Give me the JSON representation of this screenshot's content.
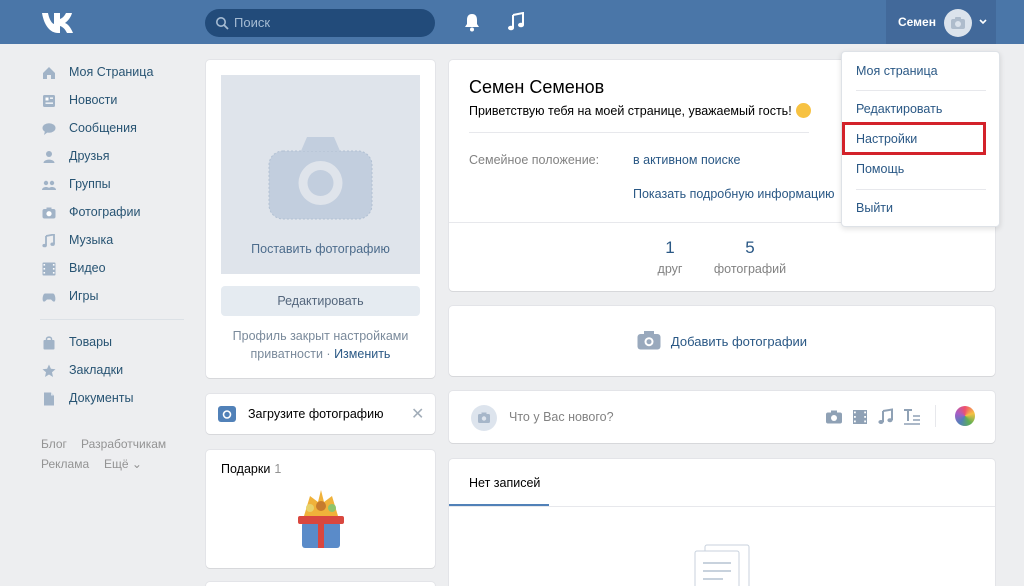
{
  "header": {
    "search_placeholder": "Поиск",
    "user_name": "Семен",
    "brand_color": "#4a76a8"
  },
  "nav": {
    "items": [
      {
        "label": "Моя Страница",
        "icon": "home-icon"
      },
      {
        "label": "Новости",
        "icon": "news-icon"
      },
      {
        "label": "Сообщения",
        "icon": "messages-icon"
      },
      {
        "label": "Друзья",
        "icon": "friends-icon"
      },
      {
        "label": "Группы",
        "icon": "groups-icon"
      },
      {
        "label": "Фотографии",
        "icon": "photos-icon"
      },
      {
        "label": "Музыка",
        "icon": "music-icon"
      },
      {
        "label": "Видео",
        "icon": "video-icon"
      },
      {
        "label": "Игры",
        "icon": "games-icon"
      },
      {
        "label": "Товары",
        "icon": "market-icon"
      },
      {
        "label": "Закладки",
        "icon": "bookmarks-icon"
      },
      {
        "label": "Документы",
        "icon": "documents-icon"
      }
    ],
    "footer": {
      "blog": "Блог",
      "developers": "Разработчикам",
      "ads": "Реклама",
      "more": "Ещё"
    }
  },
  "photo_card": {
    "placeholder_label": "Поставить фотографию",
    "edit_label": "Редактировать",
    "closed_line1": "Профиль закрыт настройками",
    "closed_line2_prefix": "приватности · ",
    "closed_link": "Изменить"
  },
  "upload_card": {
    "label": "Загрузите фотографию"
  },
  "gifts_card": {
    "title": "Подарки",
    "count": "1"
  },
  "profile": {
    "name": "Семен Семенов",
    "status": "Приветствую тебя на моей странице, уважаемый гость!",
    "relationship_label": "Семейное положение:",
    "relationship_value": "в активном поиске",
    "more_info": "Показать подробную информацию",
    "counters": [
      {
        "value": "1",
        "label": "друг"
      },
      {
        "value": "5",
        "label": "фотографий"
      }
    ]
  },
  "add_photos": {
    "label": "Добавить фотографии"
  },
  "post_box": {
    "placeholder": "Что у Вас нового?"
  },
  "wall": {
    "tab": "Нет записей"
  },
  "dropdown": {
    "items": [
      "Моя страница",
      "Редактировать",
      "Настройки",
      "Помощь",
      "Выйти"
    ],
    "highlight_color": "#d3222a"
  }
}
